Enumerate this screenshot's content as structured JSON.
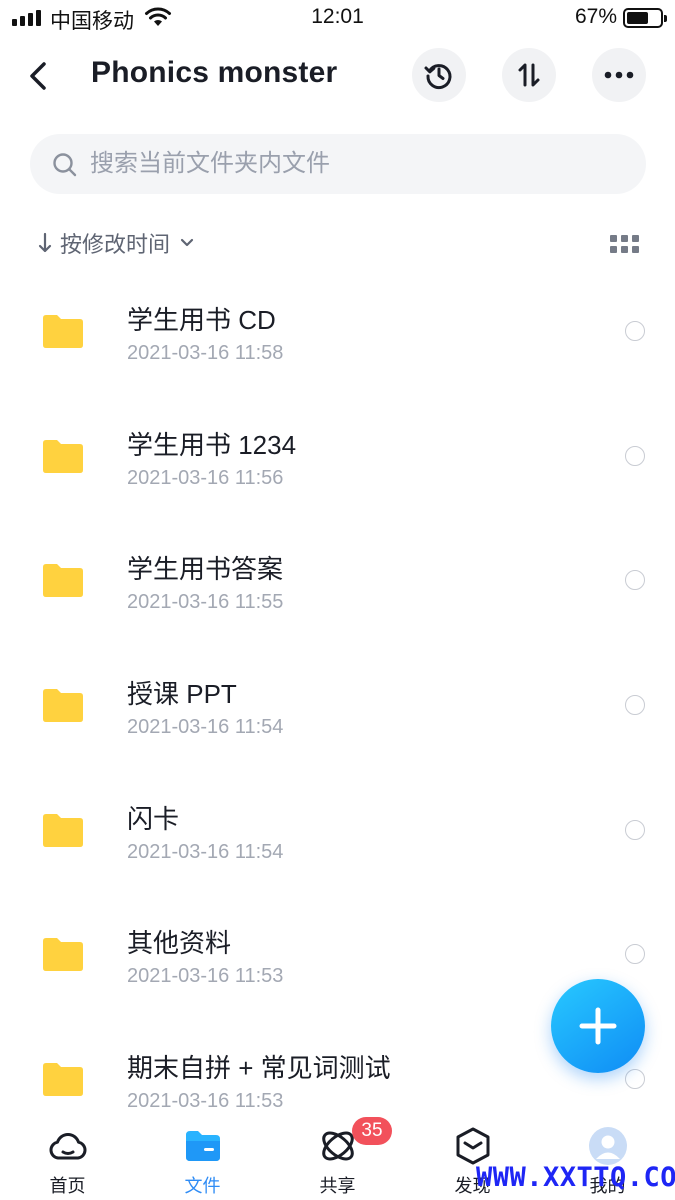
{
  "status_bar": {
    "carrier": "中国移动",
    "time": "12:01",
    "battery": "67%",
    "battery_level": 0.67
  },
  "header": {
    "title": "Phonics monster",
    "back_icon": "chevron-left-icon",
    "actions": [
      "history-icon",
      "sort-arrows-icon",
      "more-icon"
    ]
  },
  "search": {
    "placeholder": "搜索当前文件夹内文件",
    "value": "",
    "icon": "search-icon"
  },
  "sort": {
    "label": "按修改时间",
    "icon": "arrow-down-icon",
    "view_icon": "grid-view-icon"
  },
  "files": [
    {
      "name": "学生用书 CD",
      "date": "2021-03-16 11:58",
      "icon": "folder-icon"
    },
    {
      "name": "学生用书 1234",
      "date": "2021-03-16 11:56",
      "icon": "folder-icon"
    },
    {
      "name": "学生用书答案",
      "date": "2021-03-16 11:55",
      "icon": "folder-icon"
    },
    {
      "name": "授课 PPT",
      "date": "2021-03-16 11:54",
      "icon": "folder-icon"
    },
    {
      "name": "闪卡",
      "date": "2021-03-16 11:54",
      "icon": "folder-icon"
    },
    {
      "name": "其他资料",
      "date": "2021-03-16 11:53",
      "icon": "folder-icon"
    },
    {
      "name": "期末自拼 + 常见词测试",
      "date": "2021-03-16 11:53",
      "icon": "folder-icon"
    }
  ],
  "fab": {
    "icon": "plus-icon"
  },
  "tabbar": {
    "tabs": [
      {
        "label": "首页",
        "icon": "cloud-home-icon",
        "active": false
      },
      {
        "label": "文件",
        "icon": "folder-tab-icon",
        "active": true
      },
      {
        "label": "共享",
        "icon": "share-orbit-icon",
        "active": false,
        "badge": "35"
      },
      {
        "label": "发现",
        "icon": "discover-box-icon",
        "active": false
      },
      {
        "label": "我的",
        "icon": "avatar-icon",
        "active": false
      }
    ]
  },
  "watermark": "WWW.XXTTQ.COM",
  "colors": {
    "accent": "#2f8cf5",
    "folder": "#ffd23f",
    "badge": "#f2515b",
    "watermark": "#1e26f5"
  }
}
